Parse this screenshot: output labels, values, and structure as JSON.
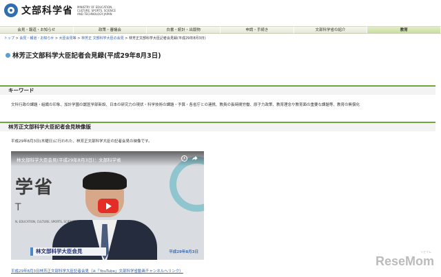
{
  "header": {
    "logo_text": "文部科学省",
    "logo_en": "MINISTRY OF EDUCATION, CULTURE, SPORTS, SCIENCE AND TECHNOLOGY-JAPAN"
  },
  "nav": {
    "items": [
      {
        "label": "会見・報道・お知らせ"
      },
      {
        "label": "政策・審議会"
      },
      {
        "label": "白書・統計・出版物"
      },
      {
        "label": "申請・手続き"
      },
      {
        "label": "文部科学省の紹介"
      },
      {
        "label": "教育"
      }
    ]
  },
  "breadcrumb": {
    "items": [
      "トップ",
      "会見・報道・お知らせ",
      "大臣会見等",
      "林芳正 文部科学大臣の会見",
      "林芳正文部科学大臣記者会見録(平成29年8月3日)"
    ],
    "separator": " > "
  },
  "page": {
    "title": "林芳正文部科学大臣記者会見録(平成29年8月3日)"
  },
  "keywords": {
    "heading": "キーワード",
    "text": "文科行政の課題・組織の印象、加計学園の獣医学部新設、日本の研究力の現状・科学技術の課題・予算・各省庁との連携、教員の長時間労働、原子力政策、教育理念や教育面の重要な課題等、教育の無償化"
  },
  "video_section": {
    "heading": "林芳正文部科学大臣記者会見映像版",
    "description": "平成29年8月3日(木曜日)に行われた、林芳正文部科学大臣の記者会見の映像です。",
    "player_title": "林文部科学大臣会見(平成29年8月3日)：文部科学省",
    "bg_text": "学省",
    "bg_letter": "T",
    "bg_small": "N, EDUCATION, CULTURE, SPORTS, SCIENCE AND TECHNOLOGY",
    "caption": "林文部科学大臣会見",
    "date_overlay": "平成29年8月3日",
    "link": "平成29年8月3日林芳正文部科学大臣記者会見（※「YouTube」文部科学省動画チャンネルへリンク）"
  },
  "watermark": {
    "text": "ReseMom",
    "small": "リセマム"
  }
}
